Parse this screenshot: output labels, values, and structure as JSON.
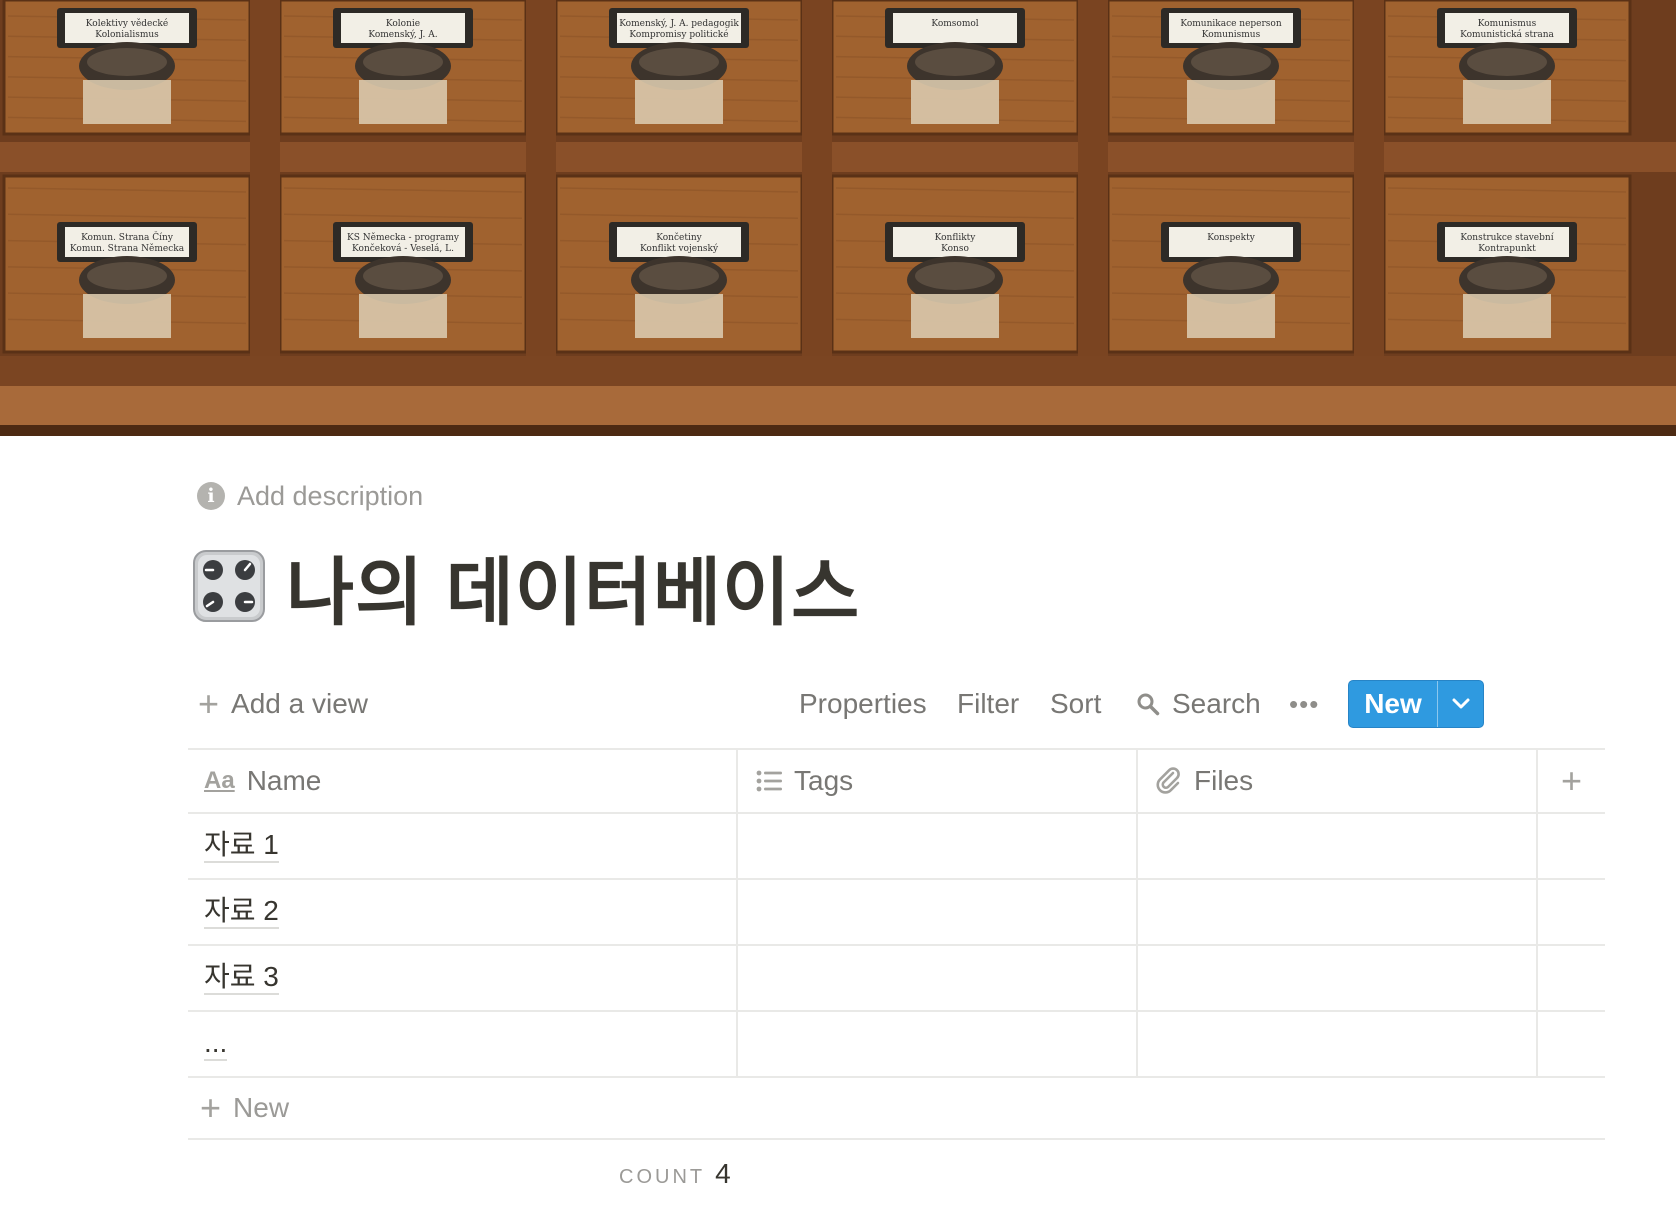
{
  "cover": {
    "drawer_labels": [
      [
        "Kolektivy vědecké",
        "Kolonialismus"
      ],
      [
        "Kolonie",
        "Komenský, J. A."
      ],
      [
        "Komenský, J. A. pedagogik",
        "Kompromisy politické"
      ],
      [
        "Komsomol",
        ""
      ],
      [
        "Komunikace neperson",
        "Komunismus"
      ],
      [
        "Komunismus",
        "Komunistická strana"
      ],
      [
        "Komun. Strana Číny",
        "Komun. Strana Německa"
      ],
      [
        "KS Německa - programy",
        "Končeková - Veselá, L."
      ],
      [
        "Končetiny",
        "Konflikt vojenský"
      ],
      [
        "Konflikty",
        "Konso"
      ],
      [
        "Konspekty",
        ""
      ],
      [
        "Konstrukce stavební",
        "Kontrapunkt"
      ]
    ]
  },
  "description": {
    "placeholder": "Add description",
    "icon": "info-icon"
  },
  "page": {
    "icon": "control-knobs-icon",
    "title": "나의 데이터베이스"
  },
  "toolbar": {
    "add_view": "Add a view",
    "properties": "Properties",
    "filter": "Filter",
    "sort": "Sort",
    "search": "Search",
    "more": "•••",
    "new_button": "New",
    "accent_color": "#2f9ae0"
  },
  "table": {
    "columns": [
      {
        "label": "Name",
        "icon": "text-type-icon"
      },
      {
        "label": "Tags",
        "icon": "list-icon"
      },
      {
        "label": "Files",
        "icon": "paperclip-icon"
      }
    ],
    "add_column_icon": "+",
    "rows": [
      {
        "name": "자료 1",
        "tags": "",
        "files": ""
      },
      {
        "name": "자료 2",
        "tags": "",
        "files": ""
      },
      {
        "name": "자료 3",
        "tags": "",
        "files": ""
      },
      {
        "name": "...",
        "tags": "",
        "files": ""
      }
    ],
    "new_row_label": "New",
    "aa_icon_text": "Aa"
  },
  "footer": {
    "count_label": "COUNT",
    "count_value": "4"
  }
}
